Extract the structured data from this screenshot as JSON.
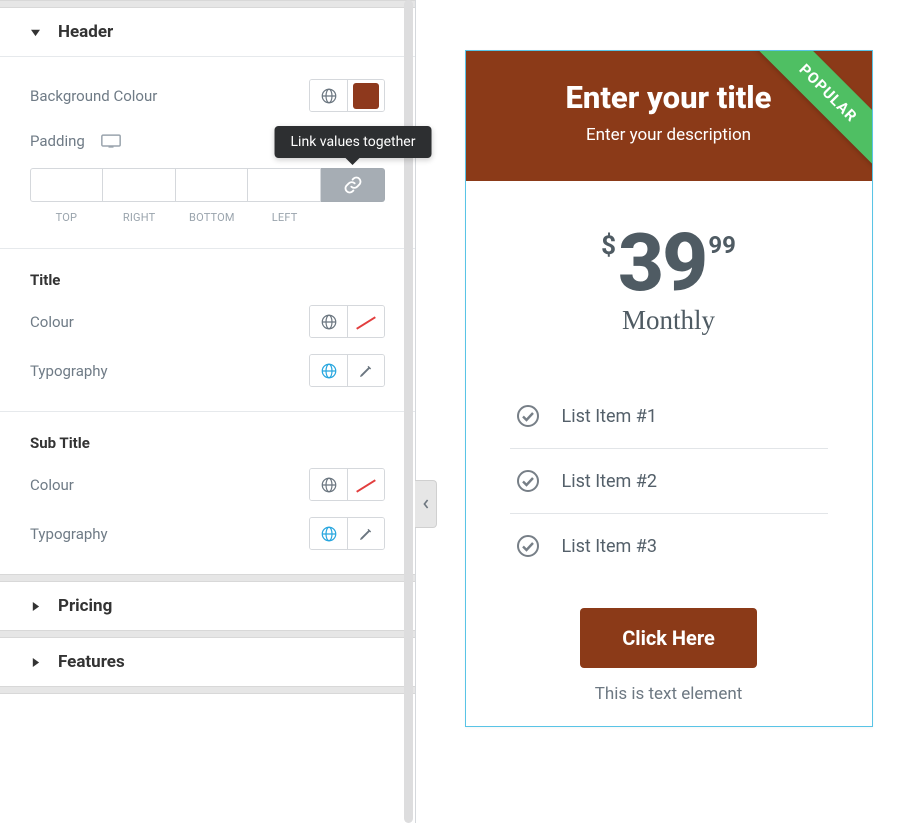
{
  "tooltip": "Link values together",
  "panel": {
    "sections": {
      "header": {
        "title": "Header",
        "bg_label": "Background Colour",
        "bg_color": "#8e391d",
        "padding_label": "Padding",
        "padding_sides": {
          "top": "TOP",
          "right": "RIGHT",
          "bottom": "BOTTOM",
          "left": "LEFT"
        },
        "title_group": {
          "heading": "Title",
          "colour_label": "Colour",
          "typography_label": "Typography"
        },
        "subtitle_group": {
          "heading": "Sub Title",
          "colour_label": "Colour",
          "typography_label": "Typography"
        }
      },
      "pricing": {
        "title": "Pricing"
      },
      "features": {
        "title": "Features"
      }
    }
  },
  "preview": {
    "ribbon": "POPULAR",
    "title": "Enter your title",
    "subtitle": "Enter your description",
    "currency": "$",
    "price": "39",
    "cents": "99",
    "period": "Monthly",
    "features": [
      "List Item #1",
      "List Item #2",
      "List Item #3"
    ],
    "button": "Click Here",
    "footnote": "This is text element"
  }
}
